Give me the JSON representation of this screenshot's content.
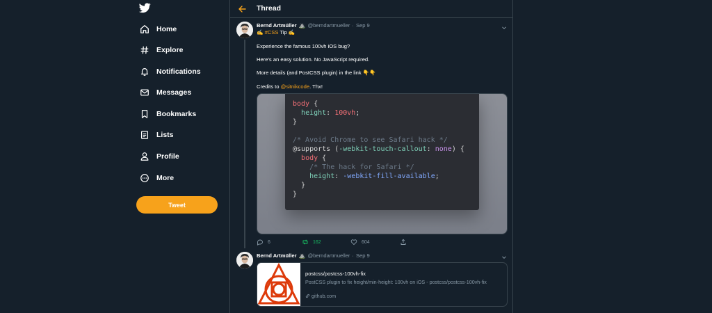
{
  "sidebar": {
    "logo": "twitter-bird-icon",
    "items": [
      {
        "label": "Home",
        "icon": "home-icon"
      },
      {
        "label": "Explore",
        "icon": "hashtag-icon"
      },
      {
        "label": "Notifications",
        "icon": "bell-icon"
      },
      {
        "label": "Messages",
        "icon": "mail-icon"
      },
      {
        "label": "Bookmarks",
        "icon": "bookmark-icon"
      },
      {
        "label": "Lists",
        "icon": "list-icon"
      },
      {
        "label": "Profile",
        "icon": "person-icon"
      },
      {
        "label": "More",
        "icon": "more-circle-icon"
      }
    ],
    "tweet_button": "Tweet"
  },
  "colors": {
    "background": "#15202b",
    "accent": "#f7a21b",
    "border": "#38444d",
    "muted": "#8899a6",
    "retweet_green": "#17bf63"
  },
  "header": {
    "title": "Thread",
    "back_icon": "arrow-left-icon"
  },
  "tweet1": {
    "name": "Bernd Artmüller",
    "badge": "⛰️",
    "handle": "@berndartmueller",
    "separator": "·",
    "date": "Sep 9",
    "line1_prefix": "✍️ ",
    "line1_hashtag": "#CSS",
    "line1_suffix": " Tip ✍️",
    "line2": "Experience the famous 100vh iOS bug?",
    "line3": "Here's an easy solution. No JavaScript required.",
    "line4": "More details (and PostCSS plugin) in the link 👇👇",
    "line5_prefix": "Credits to ",
    "line5_mention": "@sitnikcode",
    "line5_suffix": ". Thx!",
    "code": {
      "l1_sel": "body",
      "l1_brace": " {",
      "l2_prop": "height",
      "l2_colon": ": ",
      "l2_val": "100vh",
      "l2_semi": ";",
      "l3": "}",
      "l5": "/* Avoid Chrome to see Safari hack */",
      "l6_at": "@supports (",
      "l6_prop": "-webkit-touch-callout",
      "l6_colon": ": ",
      "l6_val": "none",
      "l6_end": ") {",
      "l7_sel": "body",
      "l7_brace": " {",
      "l8": "/* The hack for Safari */",
      "l9_prop": "height",
      "l9_colon": ": ",
      "l9_val": "-webkit-fill-available",
      "l9_semi": ";",
      "l10": "}",
      "l11": "}"
    },
    "actions": {
      "replies": "6",
      "retweets": "162",
      "likes": "604"
    }
  },
  "tweet2": {
    "name": "Bernd Artmüller",
    "badge": "⛰️",
    "handle": "@berndartmueller",
    "separator": "·",
    "date": "Sep 9",
    "card": {
      "title": "postcss/postcss-100vh-fix",
      "description": "PostCSS plugin to fix height/min-height: 100vh on iOS - postcss/postcss-100vh-fix",
      "domain": "github.com",
      "image_icon": "postcss-logo-icon"
    }
  }
}
